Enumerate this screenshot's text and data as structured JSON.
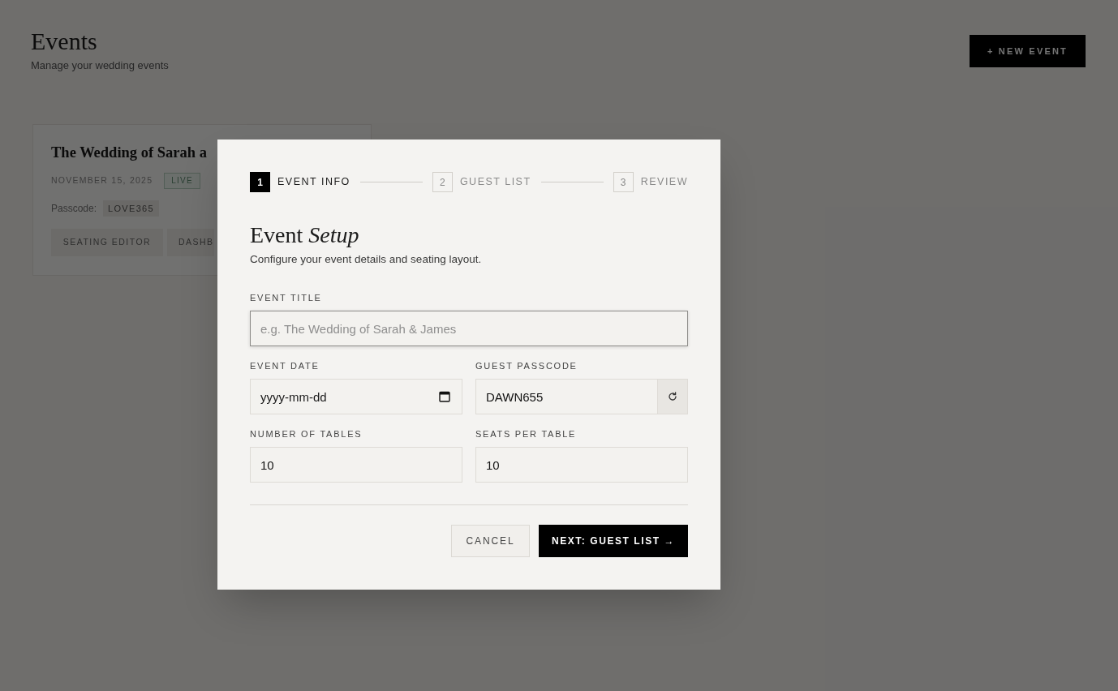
{
  "page": {
    "title": "Events",
    "subtitle": "Manage your wedding events",
    "new_event_button": "+ NEW EVENT"
  },
  "event_cards": [
    {
      "title": "The Wedding of Sarah a",
      "date": "NOVEMBER 15, 2025",
      "status": "LIVE",
      "passcode_label": "Passcode:",
      "passcode": "LOVE365",
      "actions": [
        "SEATING EDITOR",
        "DASHB"
      ]
    }
  ],
  "modal": {
    "steps": [
      {
        "number": "1",
        "label": "EVENT INFO",
        "selected": true
      },
      {
        "number": "2",
        "label": "GUEST LIST",
        "selected": false
      },
      {
        "number": "3",
        "label": "REVIEW",
        "selected": false
      }
    ],
    "title": "Event *Setup*",
    "subtitle": "Configure your event details and seating layout.",
    "fields": [
      {
        "label": "EVENT TITLE",
        "kind": "text",
        "placeholder": "e.g. The Wedding of Sarah & James",
        "focused": true
      },
      {
        "label": "EVENT DATE",
        "kind": "date",
        "placeholder": "yyyy-mm-dd",
        "focused": false
      },
      {
        "label": "GUEST PASSCODE",
        "kind": "passcode",
        "value": "DAWN655",
        "focused": false
      },
      {
        "label": "NUMBER OF TABLES",
        "kind": "number",
        "value": "10",
        "focused": false
      },
      {
        "label": "SEATS PER TABLE",
        "kind": "number",
        "value": "10",
        "focused": false
      }
    ],
    "buttons": [
      {
        "label": "CANCEL",
        "kind": "secondary"
      },
      {
        "label": "NEXT: GUEST LIST →",
        "kind": "primary"
      }
    ]
  }
}
